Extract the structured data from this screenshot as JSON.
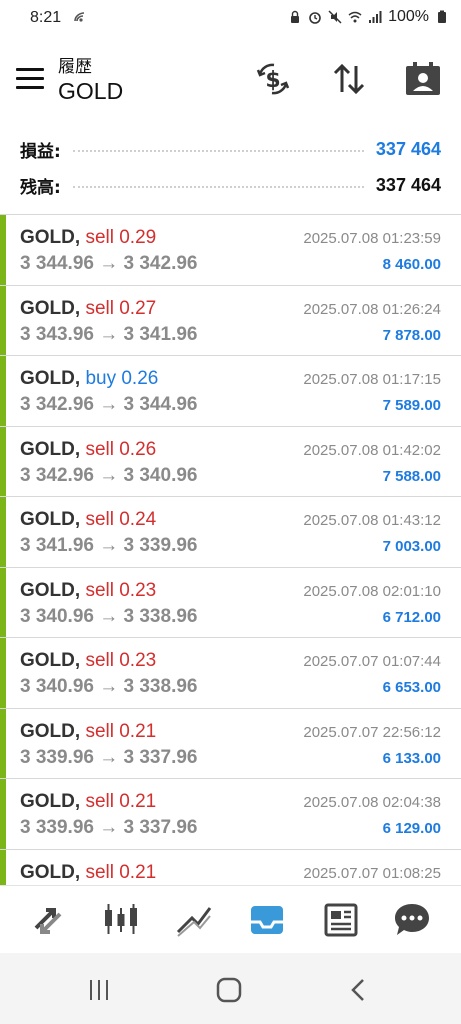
{
  "status_bar": {
    "time": "8:21",
    "battery_text": "100%"
  },
  "header": {
    "subtitle": "履歴",
    "title": "GOLD"
  },
  "summary": {
    "profit_label": "損益:",
    "profit_value": "337 464",
    "balance_label": "残高:",
    "balance_value": "337 464"
  },
  "colors": {
    "accent_blue": "#1e7be0",
    "sell_red": "#d32f2f",
    "buy_blue": "#1e7be0",
    "green_bar": "#7cb518",
    "icon_gray": "#444444",
    "nav_active": "#3a9ad9"
  },
  "trades": [
    {
      "symbol": "GOLD,",
      "side": "sell 0.29",
      "prices": "3 344.96 → 3 342.96",
      "time": "2025.07.08 01:23:59",
      "profit": "8 460.00"
    },
    {
      "symbol": "GOLD,",
      "side": "sell 0.27",
      "prices": "3 343.96 → 3 341.96",
      "time": "2025.07.08 01:26:24",
      "profit": "7 878.00"
    },
    {
      "symbol": "GOLD,",
      "side": "buy 0.26",
      "prices": "3 342.96 → 3 344.96",
      "time": "2025.07.08 01:17:15",
      "profit": "7 589.00"
    },
    {
      "symbol": "GOLD,",
      "side": "sell 0.26",
      "prices": "3 342.96 → 3 340.96",
      "time": "2025.07.08 01:42:02",
      "profit": "7 588.00"
    },
    {
      "symbol": "GOLD,",
      "side": "sell 0.24",
      "prices": "3 341.96 → 3 339.96",
      "time": "2025.07.08 01:43:12",
      "profit": "7 003.00"
    },
    {
      "symbol": "GOLD,",
      "side": "sell 0.23",
      "prices": "3 340.96 → 3 338.96",
      "time": "2025.07.08 02:01:10",
      "profit": "6 712.00"
    },
    {
      "symbol": "GOLD,",
      "side": "sell 0.23",
      "prices": "3 340.96 → 3 338.96",
      "time": "2025.07.07 01:07:44",
      "profit": "6 653.00"
    },
    {
      "symbol": "GOLD,",
      "side": "sell 0.21",
      "prices": "3 339.96 → 3 337.96",
      "time": "2025.07.07 22:56:12",
      "profit": "6 133.00"
    },
    {
      "symbol": "GOLD,",
      "side": "sell 0.21",
      "prices": "3 339.96 → 3 337.96",
      "time": "2025.07.08 02:04:38",
      "profit": "6 129.00"
    },
    {
      "symbol": "GOLD,",
      "side": "sell 0.21",
      "prices": "",
      "time": "2025.07.07 01:08:25",
      "profit": ""
    }
  ],
  "bottom_nav": [
    {
      "icon": "trade-arrows-icon"
    },
    {
      "icon": "candlesticks-icon"
    },
    {
      "icon": "trend-line-icon"
    },
    {
      "icon": "inbox-history-icon",
      "active": true
    },
    {
      "icon": "news-icon"
    },
    {
      "icon": "chat-bubble-icon"
    }
  ]
}
